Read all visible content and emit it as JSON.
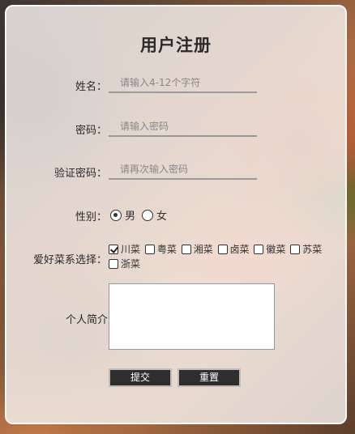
{
  "form": {
    "title": "用户注册",
    "name_label": "姓名：",
    "name_placeholder": "请输入4-12个字符",
    "password_label": "密码：",
    "password_placeholder": "请输入密码",
    "confirm_label": "验证密码：",
    "confirm_placeholder": "请再次输入密码",
    "gender_label": "性别：",
    "gender_options": [
      {
        "label": "男",
        "checked": true
      },
      {
        "label": "女",
        "checked": false
      }
    ],
    "cuisine_label": "爱好菜系选择：",
    "cuisines": [
      {
        "label": "川菜",
        "checked": true
      },
      {
        "label": "粤菜",
        "checked": false
      },
      {
        "label": "湘菜",
        "checked": false
      },
      {
        "label": "卤菜",
        "checked": false
      },
      {
        "label": "徽菜",
        "checked": false
      },
      {
        "label": "苏菜",
        "checked": false
      },
      {
        "label": "浙菜",
        "checked": false
      }
    ],
    "bio_label": "个人简介",
    "submit_label": "提交",
    "reset_label": "重置"
  }
}
